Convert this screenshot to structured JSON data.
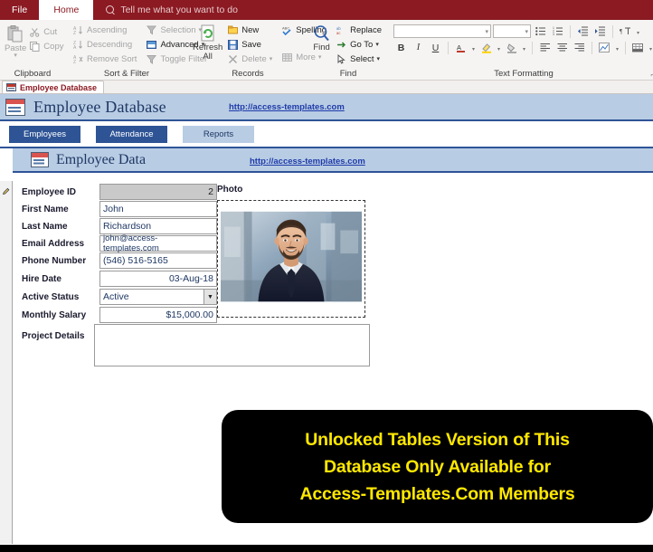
{
  "titlebar": {
    "file_tab": "File",
    "home_tab": "Home",
    "tellme_placeholder": "Tell me what you want to do",
    "accent_color": "#8b1a22"
  },
  "ribbon": {
    "groups": [
      {
        "name": "Clipboard",
        "title": "Clipboard",
        "big_button": {
          "label": "Paste",
          "icon": "clipboard-icon",
          "enabled": false
        },
        "items": [
          {
            "label": "Cut",
            "icon": "scissors-icon",
            "enabled": false
          },
          {
            "label": "Copy",
            "icon": "copy-icon",
            "enabled": false
          }
        ]
      },
      {
        "name": "SortFilter",
        "title": "Sort & Filter",
        "col1": [
          {
            "label": "Ascending",
            "icon": "sort-ascending-icon",
            "enabled": false
          },
          {
            "label": "Descending",
            "icon": "sort-descending-icon",
            "enabled": false
          },
          {
            "label": "Remove Sort",
            "icon": "remove-sort-icon",
            "enabled": false
          }
        ],
        "col2": [
          {
            "label": "Selection",
            "icon": "filter-selection-icon",
            "enabled": false,
            "dropdown": true
          },
          {
            "label": "Advanced",
            "icon": "advanced-filter-icon",
            "enabled": true,
            "dropdown": true
          },
          {
            "label": "Toggle Filter",
            "icon": "toggle-filter-icon",
            "enabled": false
          }
        ]
      },
      {
        "name": "Records",
        "title": "Records",
        "big_button": {
          "label": "Refresh All",
          "icon": "refresh-icon",
          "enabled": true,
          "dropdown": true
        },
        "col1": [
          {
            "label": "New",
            "icon": "new-record-icon",
            "enabled": true
          },
          {
            "label": "Save",
            "icon": "save-icon",
            "enabled": true
          },
          {
            "label": "Delete",
            "icon": "delete-icon",
            "enabled": false,
            "dropdown": true
          }
        ],
        "col2": [
          {
            "label": "Spelling",
            "icon": "spelling-icon",
            "enabled": true
          },
          {
            "label": "More",
            "icon": "more-icon",
            "enabled": false,
            "dropdown": true
          }
        ]
      },
      {
        "name": "Find",
        "title": "Find",
        "big_button": {
          "label": "Find",
          "icon": "magnifier-icon",
          "enabled": true
        },
        "items": [
          {
            "label": "Replace",
            "icon": "replace-icon",
            "enabled": true
          },
          {
            "label": "Go To",
            "icon": "goto-arrow-icon",
            "enabled": true,
            "dropdown": true
          },
          {
            "label": "Select",
            "icon": "select-cursor-icon",
            "enabled": true,
            "dropdown": true
          }
        ]
      },
      {
        "name": "TextFormatting",
        "title": "Text Formatting",
        "font_family_value": "",
        "font_size_value": "",
        "row1_icons": [
          "bulleted-list-icon",
          "numbered-list-icon",
          "decrease-indent-icon",
          "increase-indent-icon",
          "text-direction-icon"
        ],
        "row2_icons": [
          "bold-icon",
          "italic-icon",
          "underline-icon",
          "font-color-icon",
          "text-highlight-icon",
          "fill-color-icon",
          "align-left-icon",
          "align-center-icon",
          "align-right-icon",
          "conditional-formatting-icon",
          "gridlines-icon"
        ],
        "bold_label": "B",
        "italic_label": "I",
        "underline_label": "U",
        "fontcolor_label": "A",
        "dialog_launcher": "dialog-box-launcher-icon"
      }
    ]
  },
  "document_tab": {
    "label": "Employee Database",
    "icon": "form-object-icon"
  },
  "form_header": {
    "title": "Employee Database",
    "link": "http://access-templates.com",
    "icon": "form-object-icon",
    "bar_color": "#b8cce4",
    "border_color": "#2e5496"
  },
  "nav_buttons": [
    {
      "label": "Employees",
      "active": true
    },
    {
      "label": "Attendance",
      "active": true
    },
    {
      "label": "Reports",
      "active": false
    }
  ],
  "subform_header": {
    "title": "Employee Data",
    "link": "http://access-templates.com",
    "icon": "form-object-icon"
  },
  "form_fields": [
    {
      "label": "Employee ID",
      "value": "2",
      "type": "locked",
      "align": "right"
    },
    {
      "label": "First Name",
      "value": "John",
      "type": "text",
      "align": "left"
    },
    {
      "label": "Last Name",
      "value": "Richardson",
      "type": "text",
      "align": "left"
    },
    {
      "label": "Email Address",
      "value": "john@access-templates.com",
      "type": "text",
      "align": "left"
    },
    {
      "label": "Phone Number",
      "value": "(546) 516-5165",
      "type": "text",
      "align": "left"
    },
    {
      "label": "Hire Date",
      "value": "03-Aug-18",
      "type": "text",
      "align": "right"
    },
    {
      "label": "Active Status",
      "value": "Active",
      "type": "combobox",
      "align": "left"
    },
    {
      "label": "Monthly Salary",
      "value": "$15,000.00",
      "type": "text",
      "align": "right"
    },
    {
      "label": "Project Details",
      "value": "",
      "type": "textarea",
      "align": "left"
    }
  ],
  "photo": {
    "label": "Photo",
    "alt": "Portrait of a smiling bearded man in a dark suit with a blurred glass building background"
  },
  "record_selector": {
    "state": "editing",
    "icon": "pencil-edit-icon"
  },
  "banner": {
    "lines": [
      "Unlocked Tables Version of This",
      "Database Only Available for",
      "Access-Templates.Com Members"
    ],
    "text_color": "#ffe800",
    "background_color": "#000000"
  }
}
